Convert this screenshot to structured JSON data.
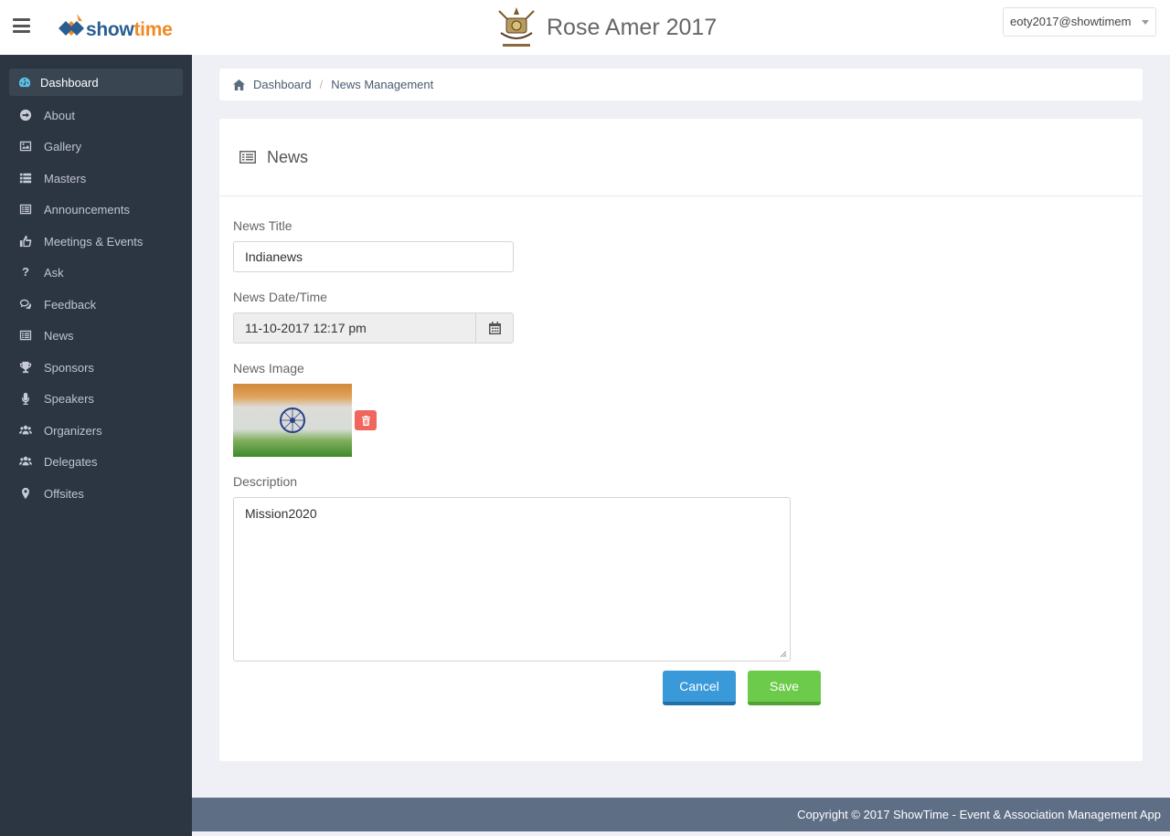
{
  "header": {
    "logo": {
      "part1": "show",
      "part2": "time"
    },
    "event_title": "Rose Amer 2017",
    "user_email": "eoty2017@showtimem"
  },
  "sidebar": {
    "items": [
      {
        "label": "Dashboard",
        "icon": "dashboard-icon",
        "active": true
      },
      {
        "label": "About",
        "icon": "arrow-circle-right-icon"
      },
      {
        "label": "Gallery",
        "icon": "picture-icon"
      },
      {
        "label": "Masters",
        "icon": "list-icon"
      },
      {
        "label": "Announcements",
        "icon": "list-alt-icon"
      },
      {
        "label": "Meetings & Events",
        "icon": "thumbs-up-icon"
      },
      {
        "label": "Ask",
        "icon": "question-icon"
      },
      {
        "label": "Feedback",
        "icon": "comments-icon"
      },
      {
        "label": "News",
        "icon": "list-alt-icon"
      },
      {
        "label": "Sponsors",
        "icon": "trophy-icon"
      },
      {
        "label": "Speakers",
        "icon": "microphone-icon"
      },
      {
        "label": "Organizers",
        "icon": "users-icon"
      },
      {
        "label": "Delegates",
        "icon": "users-icon"
      },
      {
        "label": "Offsites",
        "icon": "map-marker-icon"
      }
    ]
  },
  "breadcrumb": {
    "home": "Dashboard",
    "current": "News Management"
  },
  "panel": {
    "title": "News",
    "news_title_label": "News Title",
    "news_title_value": "Indianews",
    "date_label": "News Date/Time",
    "date_value": "11-10-2017 12:17 pm",
    "image_label": "News Image",
    "description_label": "Description",
    "description_value": "Mission2020",
    "cancel_label": "Cancel",
    "save_label": "Save"
  },
  "footer": {
    "copyright": "Copyright © 2017 ShowTime - Event & Association Management App"
  },
  "colors": {
    "sidebar_bg": "#2c3542",
    "accent_blue": "#3a9ad9",
    "accent_green": "#6ccb4a",
    "delete_red": "#f0665c",
    "footer_bg": "#5e6e85"
  }
}
